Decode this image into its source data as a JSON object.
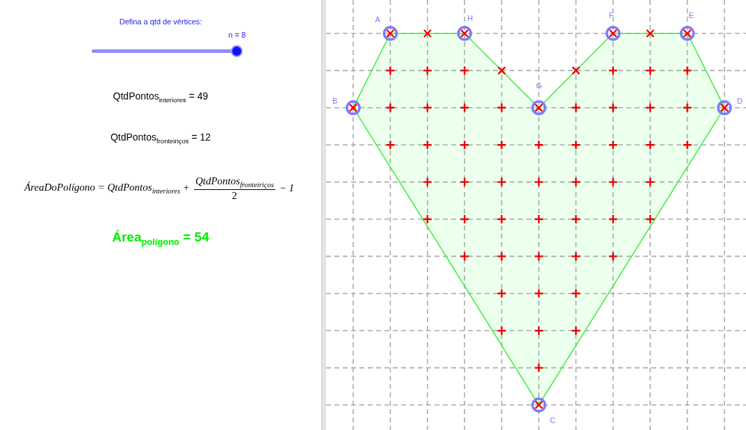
{
  "algebra_panel": {
    "prompt": "Defina a qtd de vértices:",
    "slider": {
      "label": "n = 8",
      "level": 1
    },
    "interior_count": "QtdPontos$_{interiores}$ = 49",
    "boundary_count": "QtdPontos$_{fronteiriços}$ = 12",
    "formula": {
      "left": "ÁreaDoPolígono = QtdPontos$_{interiores}$ +",
      "numerator": "QtdPontos$_{fronteiriços}$",
      "denominator": "2",
      "tail": "− 1"
    },
    "area_result": "Área$_{polígono}$ = 54"
  },
  "canvas": {
    "vertices": [
      {
        "label": "A"
      },
      {
        "label": "H"
      },
      {
        "label": "G"
      },
      {
        "label": "F"
      },
      {
        "label": "E"
      },
      {
        "label": "D"
      },
      {
        "label": "C"
      },
      {
        "label": "B"
      }
    ]
  }
}
